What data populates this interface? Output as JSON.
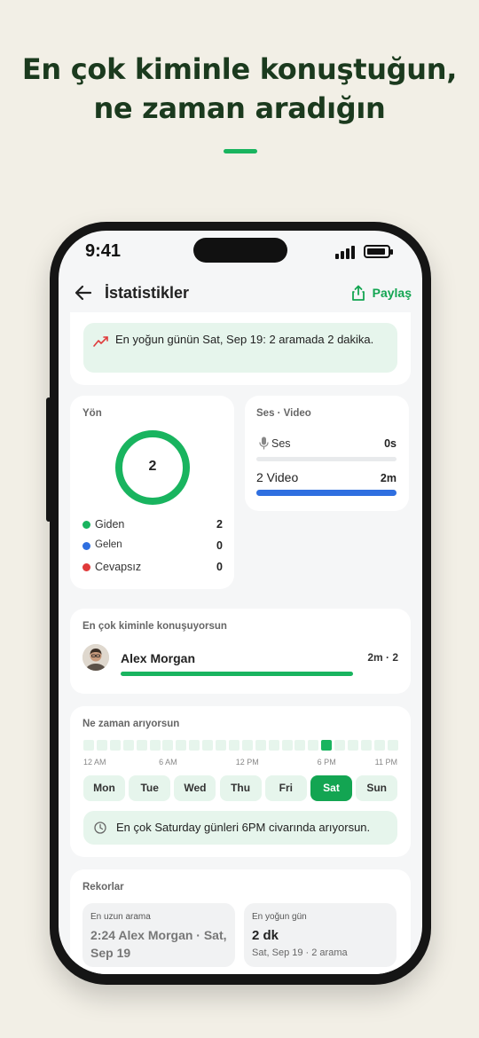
{
  "headline": {
    "line1": "En çok kiminle konuştuğun,",
    "line2": "ne zaman aradığın"
  },
  "colors": {
    "brand_green": "#13a552",
    "outgoing": "#19b45f",
    "incoming": "#2f6fe0",
    "missed": "#e03a3a",
    "video_bar": "#2f6fe0",
    "background": "#f2efe6"
  },
  "status_bar": {
    "time": "9:41",
    "icons": [
      "signal-icon",
      "battery-icon"
    ]
  },
  "navbar": {
    "back_icon": "arrow-left-icon",
    "title": "İstatistikler",
    "share_icon": "share-icon",
    "share_label": "Paylaş"
  },
  "peak_insight": {
    "icon": "trend-chart-icon",
    "text": "En yoğun günün Sat, Sep 19: 2 aramada 2 dakika."
  },
  "direction": {
    "title": "Yön",
    "total": "2",
    "items": [
      {
        "name": "Giden",
        "value": "2",
        "color": "#19b45f"
      },
      {
        "name": "Gelen",
        "value": "0",
        "color": "#2f6fe0"
      },
      {
        "name": "Cevapsız",
        "value": "0",
        "color": "#e03a3a"
      }
    ]
  },
  "media": {
    "title": "Ses · Video",
    "voice_icon": "microphone-icon",
    "voice_label": "Ses",
    "voice_value": "0s",
    "voice_fraction": 0,
    "video_label": "2 Video",
    "video_value": "2m",
    "video_fraction": 1
  },
  "top_contacts": {
    "title": "En çok kiminle konuşuyorsun",
    "contacts": [
      {
        "name": "Alex Morgan",
        "stat": "2m · 2",
        "fraction": 1
      }
    ]
  },
  "time_of_day": {
    "title": "Ne zaman arıyorsun",
    "peak_hour_index": 18,
    "hour_labels": [
      "12 AM",
      "6 AM",
      "12 PM",
      "6 PM",
      "11 PM"
    ],
    "days": [
      "Mon",
      "Tue",
      "Wed",
      "Thu",
      "Fri",
      "Sat",
      "Sun"
    ],
    "active_day": "Sat",
    "insight_icon": "clock-icon",
    "insight": "En çok Saturday günleri 6PM civarında arıyorsun."
  },
  "records": {
    "title": "Rekorlar",
    "longest": {
      "label": "En uzun arama",
      "value": "2:24 Alex Morgan · Sat, Sep 19"
    },
    "busiest": {
      "label": "En yoğun gün",
      "value": "2 dk",
      "sub": "Sat, Sep 19 · 2 arama"
    }
  }
}
